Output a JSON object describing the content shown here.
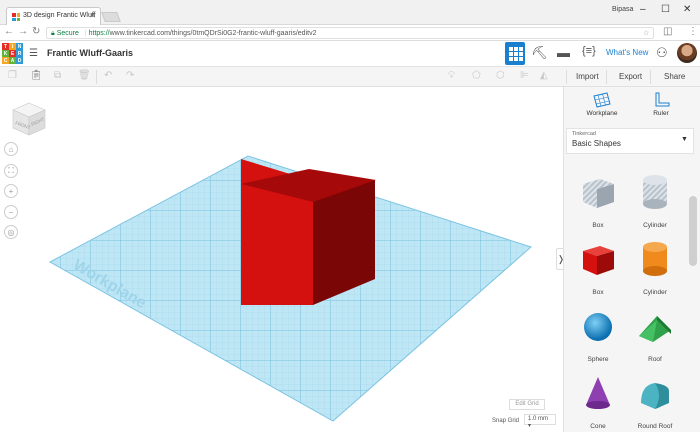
{
  "browser": {
    "tab_title": "3D design Frantic Wluff",
    "user": "Bipasa",
    "secure_label": "Secure",
    "url_proto": "https://",
    "url_rest": "www.tinkercad.com/things/0tmQDrSi0G2-frantic-wluff-gaaris/editv2"
  },
  "app": {
    "logo_letters": [
      "TIN",
      "KER",
      "CAD"
    ],
    "design_title": "Frantic Wluff-Gaaris",
    "whats_new": "What's New"
  },
  "toolbar": {
    "import": "Import",
    "export": "Export",
    "share": "Share"
  },
  "viewport": {
    "workplane_label": "Workplane",
    "viewcube_front": "FRONT",
    "viewcube_right": "RIGHT",
    "edit_grid": "Edit Grid",
    "snap_grid_label": "Snap Grid",
    "snap_grid_value": "1.0 mm ▾"
  },
  "panel": {
    "tools": [
      {
        "label": "Workplane"
      },
      {
        "label": "Ruler"
      }
    ],
    "library_provider": "Tinkercad",
    "library_name": "Basic Shapes",
    "shapes": [
      {
        "label": "Box"
      },
      {
        "label": "Cylinder"
      },
      {
        "label": "Box"
      },
      {
        "label": "Cylinder"
      },
      {
        "label": "Sphere"
      },
      {
        "label": "Roof"
      },
      {
        "label": "Cone"
      },
      {
        "label": "Round Roof"
      }
    ]
  },
  "colors": {
    "accent": "#1b7fd0",
    "box_red": "#d4110e",
    "grid_blue": "#bfe6f5",
    "roof_green": "#2fa14a",
    "cyl_orange": "#f08a1c",
    "sphere_blue": "#1a8fd0",
    "cone_purple": "#8e3fb0",
    "roundroof_teal": "#4bb3c1"
  }
}
